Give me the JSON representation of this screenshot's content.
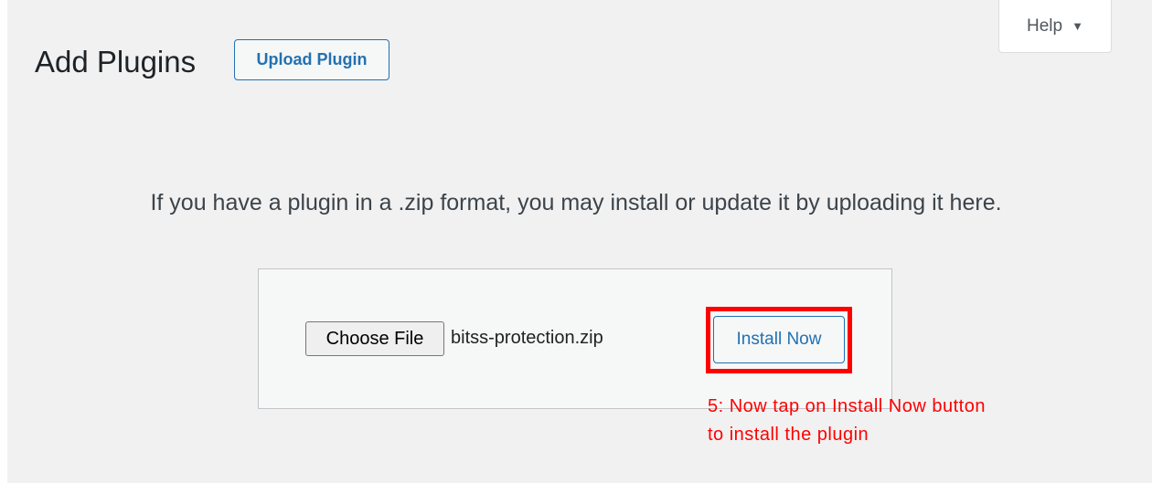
{
  "header": {
    "help_label": "Help",
    "help_arrow": "▼",
    "title": "Add Plugins",
    "upload_button_label": "Upload Plugin"
  },
  "upload": {
    "help_text": "If you have a plugin in a .zip format, you may install or update it by uploading it here.",
    "choose_file_label": "Choose File",
    "selected_file": "bitss-protection.zip",
    "install_button_label": "Install Now"
  },
  "annotation": {
    "line1": "5: Now tap on Install Now button",
    "line2": "to install the plugin",
    "color": "#ff0000"
  },
  "colors": {
    "accent": "#2271b1",
    "background": "#f1f1f1"
  }
}
